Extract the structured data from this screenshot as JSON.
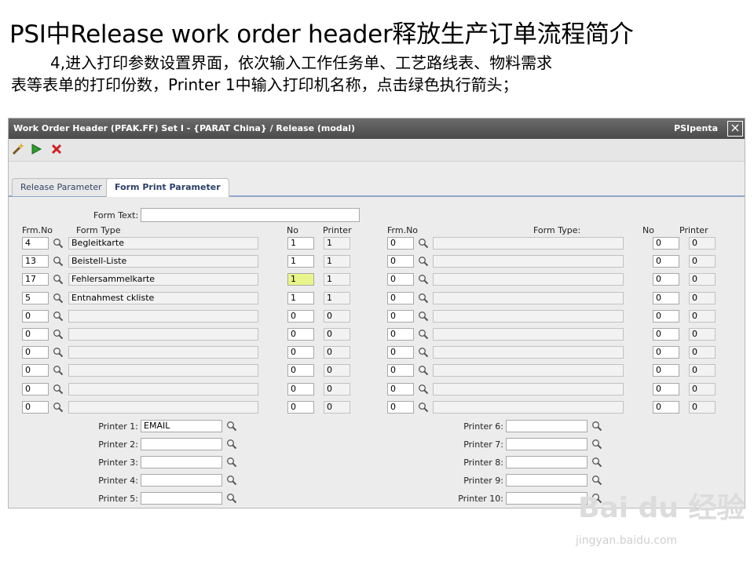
{
  "slide": {
    "title": "PSI中Release work order header释放生产订单流程简介",
    "line1": "4,进入打印参数设置界面，依次输入工作任务单、工艺路线表、物料需求",
    "line2": "表等表单的打印份数，Printer 1中输入打印机名称，点击绿色执行箭头；"
  },
  "window": {
    "title": "Work Order Header  (PFAK.FF)  Set I - {PARAT China} / Release (modal)",
    "brand": "PSIpenta",
    "close_icon": "close-icon"
  },
  "toolbar": {
    "icons": [
      "wand-icon",
      "play-icon",
      "cancel-icon"
    ]
  },
  "tabs": [
    {
      "label": "Release Parameter",
      "active": false
    },
    {
      "label": "Form Print Parameter",
      "active": true
    }
  ],
  "form": {
    "form_text_label": "Form Text:",
    "form_text_value": "",
    "left_headers": {
      "frm_no": "Frm.No",
      "form_type": "Form Type",
      "no": "No",
      "printer": "Printer"
    },
    "right_headers": {
      "frm_no": "Frm.No",
      "form_type": "Form Type:",
      "no": "No",
      "printer": "Printer"
    },
    "left_rows": [
      {
        "frm_no": "4",
        "form_type": "Begleitkarte",
        "no": "1",
        "printer": "1"
      },
      {
        "frm_no": "13",
        "form_type": "Beistell-Liste",
        "no": "1",
        "printer": "1"
      },
      {
        "frm_no": "17",
        "form_type": "Fehlersammelkarte",
        "no": "1",
        "printer": "1"
      },
      {
        "frm_no": "5",
        "form_type": "Entnahmest ckliste",
        "no": "1",
        "printer": "1"
      },
      {
        "frm_no": "0",
        "form_type": "",
        "no": "0",
        "printer": "0"
      },
      {
        "frm_no": "0",
        "form_type": "",
        "no": "0",
        "printer": "0"
      },
      {
        "frm_no": "0",
        "form_type": "",
        "no": "0",
        "printer": "0"
      },
      {
        "frm_no": "0",
        "form_type": "",
        "no": "0",
        "printer": "0"
      },
      {
        "frm_no": "0",
        "form_type": "",
        "no": "0",
        "printer": "0"
      },
      {
        "frm_no": "0",
        "form_type": "",
        "no": "0",
        "printer": "0"
      }
    ],
    "right_rows": [
      {
        "frm_no": "0",
        "form_type": "",
        "no": "0",
        "printer": "0"
      },
      {
        "frm_no": "0",
        "form_type": "",
        "no": "0",
        "printer": "0"
      },
      {
        "frm_no": "0",
        "form_type": "",
        "no": "0",
        "printer": "0"
      },
      {
        "frm_no": "0",
        "form_type": "",
        "no": "0",
        "printer": "0"
      },
      {
        "frm_no": "0",
        "form_type": "",
        "no": "0",
        "printer": "0"
      },
      {
        "frm_no": "0",
        "form_type": "",
        "no": "0",
        "printer": "0"
      },
      {
        "frm_no": "0",
        "form_type": "",
        "no": "0",
        "printer": "0"
      },
      {
        "frm_no": "0",
        "form_type": "",
        "no": "0",
        "printer": "0"
      },
      {
        "frm_no": "0",
        "form_type": "",
        "no": "0",
        "printer": "0"
      },
      {
        "frm_no": "0",
        "form_type": "",
        "no": "0",
        "printer": "0"
      }
    ],
    "printers_left": [
      {
        "label": "Printer 1:",
        "value": "EMAIL"
      },
      {
        "label": "Printer 2:",
        "value": ""
      },
      {
        "label": "Printer 3:",
        "value": ""
      },
      {
        "label": "Printer 4:",
        "value": ""
      },
      {
        "label": "Printer 5:",
        "value": ""
      }
    ],
    "printers_right": [
      {
        "label": "Printer 6:",
        "value": ""
      },
      {
        "label": "Printer 7:",
        "value": ""
      },
      {
        "label": "Printer 8:",
        "value": ""
      },
      {
        "label": "Printer 9:",
        "value": ""
      },
      {
        "label": "Printer 10:",
        "value": ""
      }
    ]
  },
  "watermark": {
    "brand": "Bai du 经验",
    "url": "jingyan.baidu.com"
  }
}
